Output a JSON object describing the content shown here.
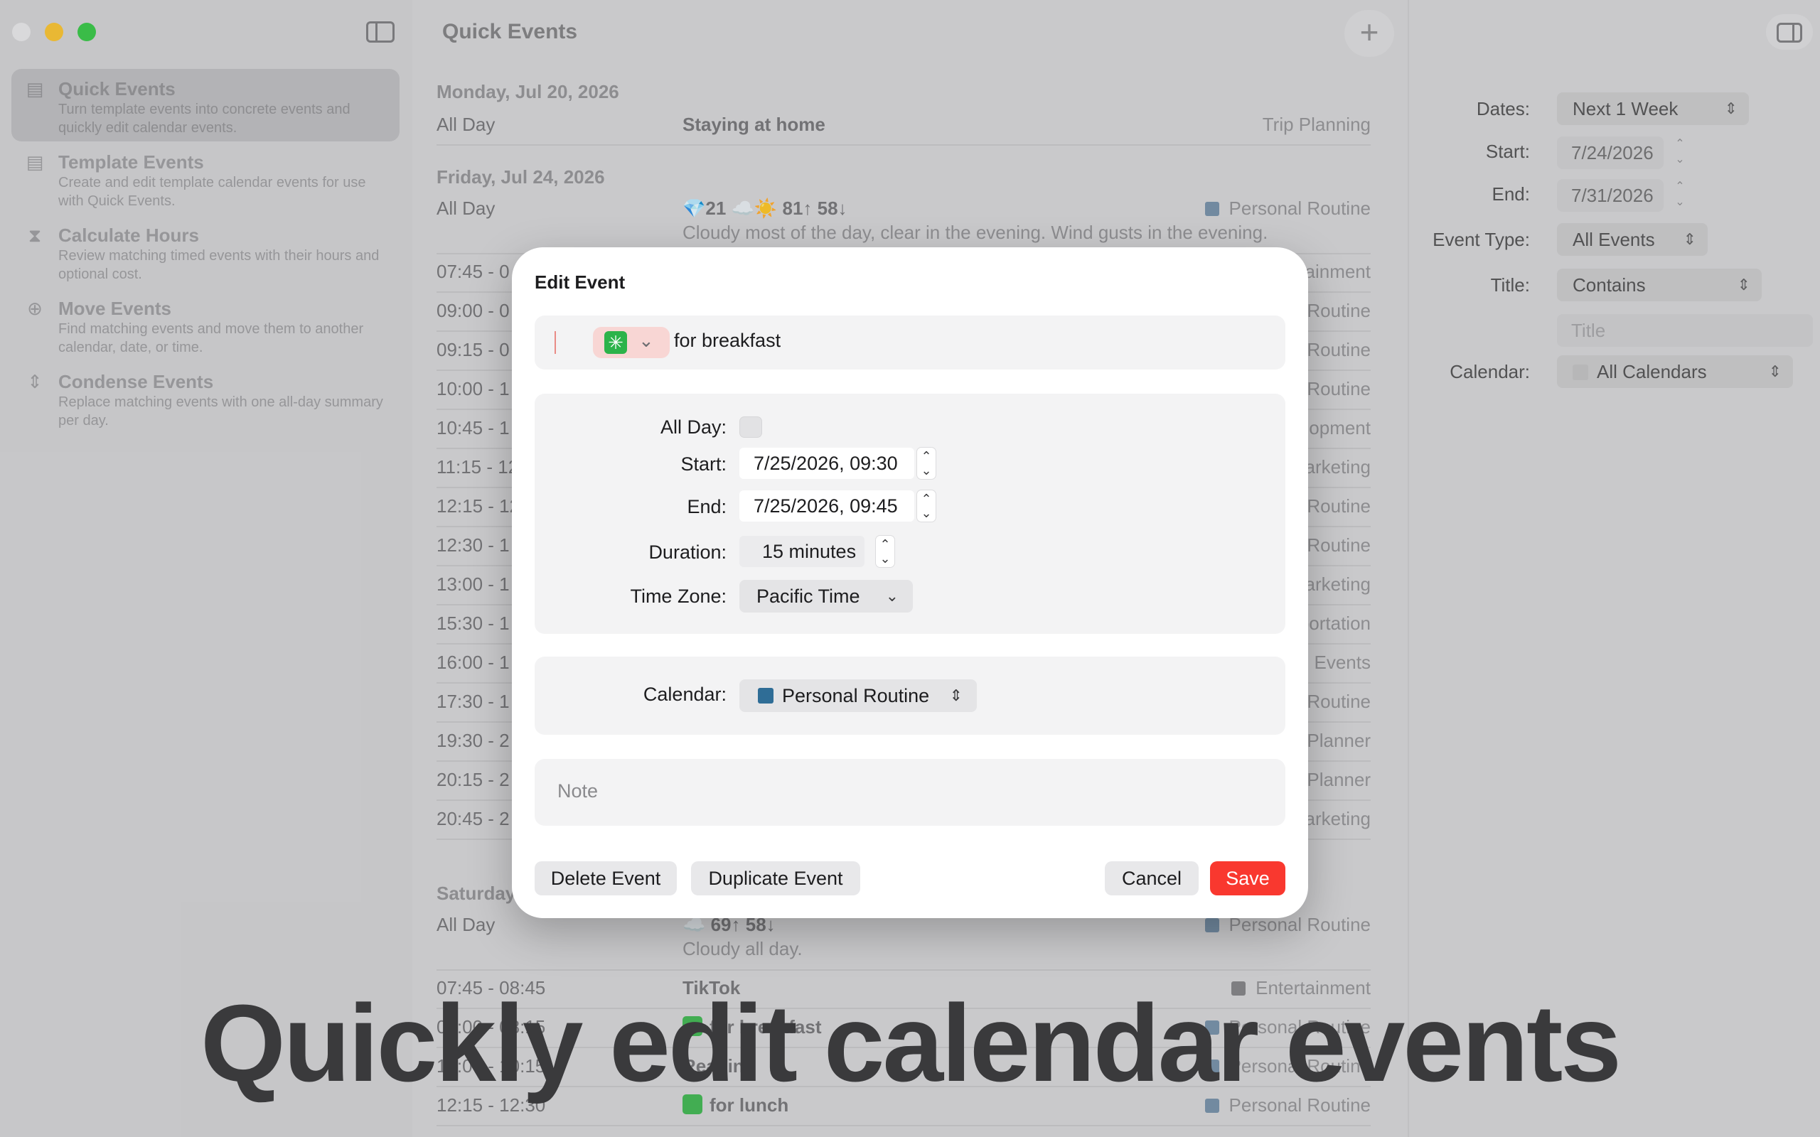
{
  "sidebar": {
    "items": [
      {
        "label": "Quick Events",
        "desc": "Turn template events into concrete events and quickly edit calendar events.",
        "icon": "quick-events-icon",
        "active": true
      },
      {
        "label": "Template Events",
        "desc": "Create and edit template calendar events for use with Quick Events.",
        "icon": "template-events-icon"
      },
      {
        "label": "Calculate Hours",
        "desc": "Review matching timed events with their hours and optional cost.",
        "icon": "hourglass-icon"
      },
      {
        "label": "Move Events",
        "desc": "Find matching events and move them to another calendar, date, or time.",
        "icon": "move-arrow-icon"
      },
      {
        "label": "Condense Events",
        "desc": "Replace matching events with one all-day summary per day.",
        "icon": "condense-icon"
      }
    ]
  },
  "main": {
    "title": "Quick Events",
    "add_label": "+",
    "sections": [
      {
        "date": "Monday, Jul 20, 2026"
      },
      {
        "date": "Friday, Jul 24, 2026"
      },
      {
        "date": "Saturday"
      }
    ],
    "rows": [
      {
        "time": "All Day",
        "title": "Staying at home",
        "cal": "Trip Planning"
      },
      {
        "time": "All Day",
        "title": "💎21 ☁️☀️ 81↑ 58↓",
        "sub": "Cloudy most of the day, clear in the evening. Wind gusts in the evening.",
        "cal": "Personal Routine"
      },
      {
        "time": "07:45 - 0",
        "cal": "rtainment"
      },
      {
        "time": "09:00 - 0",
        "cal": "l Routine"
      },
      {
        "time": "09:15 - 0",
        "cal": "l Routine"
      },
      {
        "time": "10:00 - 1",
        "cal": "l Routine"
      },
      {
        "time": "10:45 - 1",
        "cal": "elopment"
      },
      {
        "time": "11:15 - 12",
        "cal": "Marketing"
      },
      {
        "time": "12:15 - 12",
        "cal": "l Routine"
      },
      {
        "time": "12:30 - 1",
        "cal": "l Routine"
      },
      {
        "time": "13:00 - 1",
        "cal": "Marketing"
      },
      {
        "time": "15:30 - 1",
        "cal": "portation"
      },
      {
        "time": "16:00 - 1",
        "cal": "ed Events"
      },
      {
        "time": "17:30 - 1",
        "cal": "l Routine"
      },
      {
        "time": "19:30 - 2",
        "cal": "etPlanner"
      },
      {
        "time": "20:15 - 2",
        "cal": "etPlanner"
      },
      {
        "time": "20:45 - 2",
        "cal": "Marketing"
      },
      {
        "time": "All Day",
        "title": "☁️ 69↑ 58↓",
        "sub": "Cloudy all day.",
        "cal": "Personal Routine"
      },
      {
        "time": "07:45 - 08:45",
        "title": "TikTok",
        "cal": "Entertainment"
      },
      {
        "time": "08:00 - 08:15",
        "title": "for breakfast",
        "cal": "Personal Routine"
      },
      {
        "time": "10:00 - 10:15",
        "title": "Reading",
        "cal": "Personal Routine"
      },
      {
        "time": "12:15 - 12:30",
        "title": "for lunch",
        "cal": "Personal Routine"
      }
    ]
  },
  "inspector": {
    "dates_label": "Dates:",
    "dates_value": "Next 1 Week",
    "start_label": "Start:",
    "start_value": "7/24/2026",
    "end_label": "End:",
    "end_value": "7/31/2026",
    "event_type_label": "Event Type:",
    "event_type_value": "All Events",
    "title_label": "Title:",
    "title_mode": "Contains",
    "title_placeholder": "Title",
    "calendar_label": "Calendar:",
    "calendar_value": "All Calendars"
  },
  "dialog": {
    "title": "Edit Event",
    "event_title": "for breakfast",
    "emoji_icon": "green-asterisk-emoji-icon",
    "all_day_label": "All Day:",
    "start_label": "Start:",
    "start_value": "7/25/2026, 09:30",
    "end_label": "End:",
    "end_value": "7/25/2026, 09:45",
    "duration_label": "Duration:",
    "duration_value": "15 minutes",
    "timezone_label": "Time Zone:",
    "timezone_value": "Pacific Time",
    "calendar_label": "Calendar:",
    "calendar_value": "Personal Routine",
    "note_placeholder": "Note",
    "delete_label": "Delete Event",
    "duplicate_label": "Duplicate Event",
    "cancel_label": "Cancel",
    "save_label": "Save"
  },
  "caption": "Quickly edit calendar events",
  "colors": {
    "save": "#f9382f",
    "personal_routine": "#2f6d96",
    "emoji_green": "#2db34a"
  }
}
